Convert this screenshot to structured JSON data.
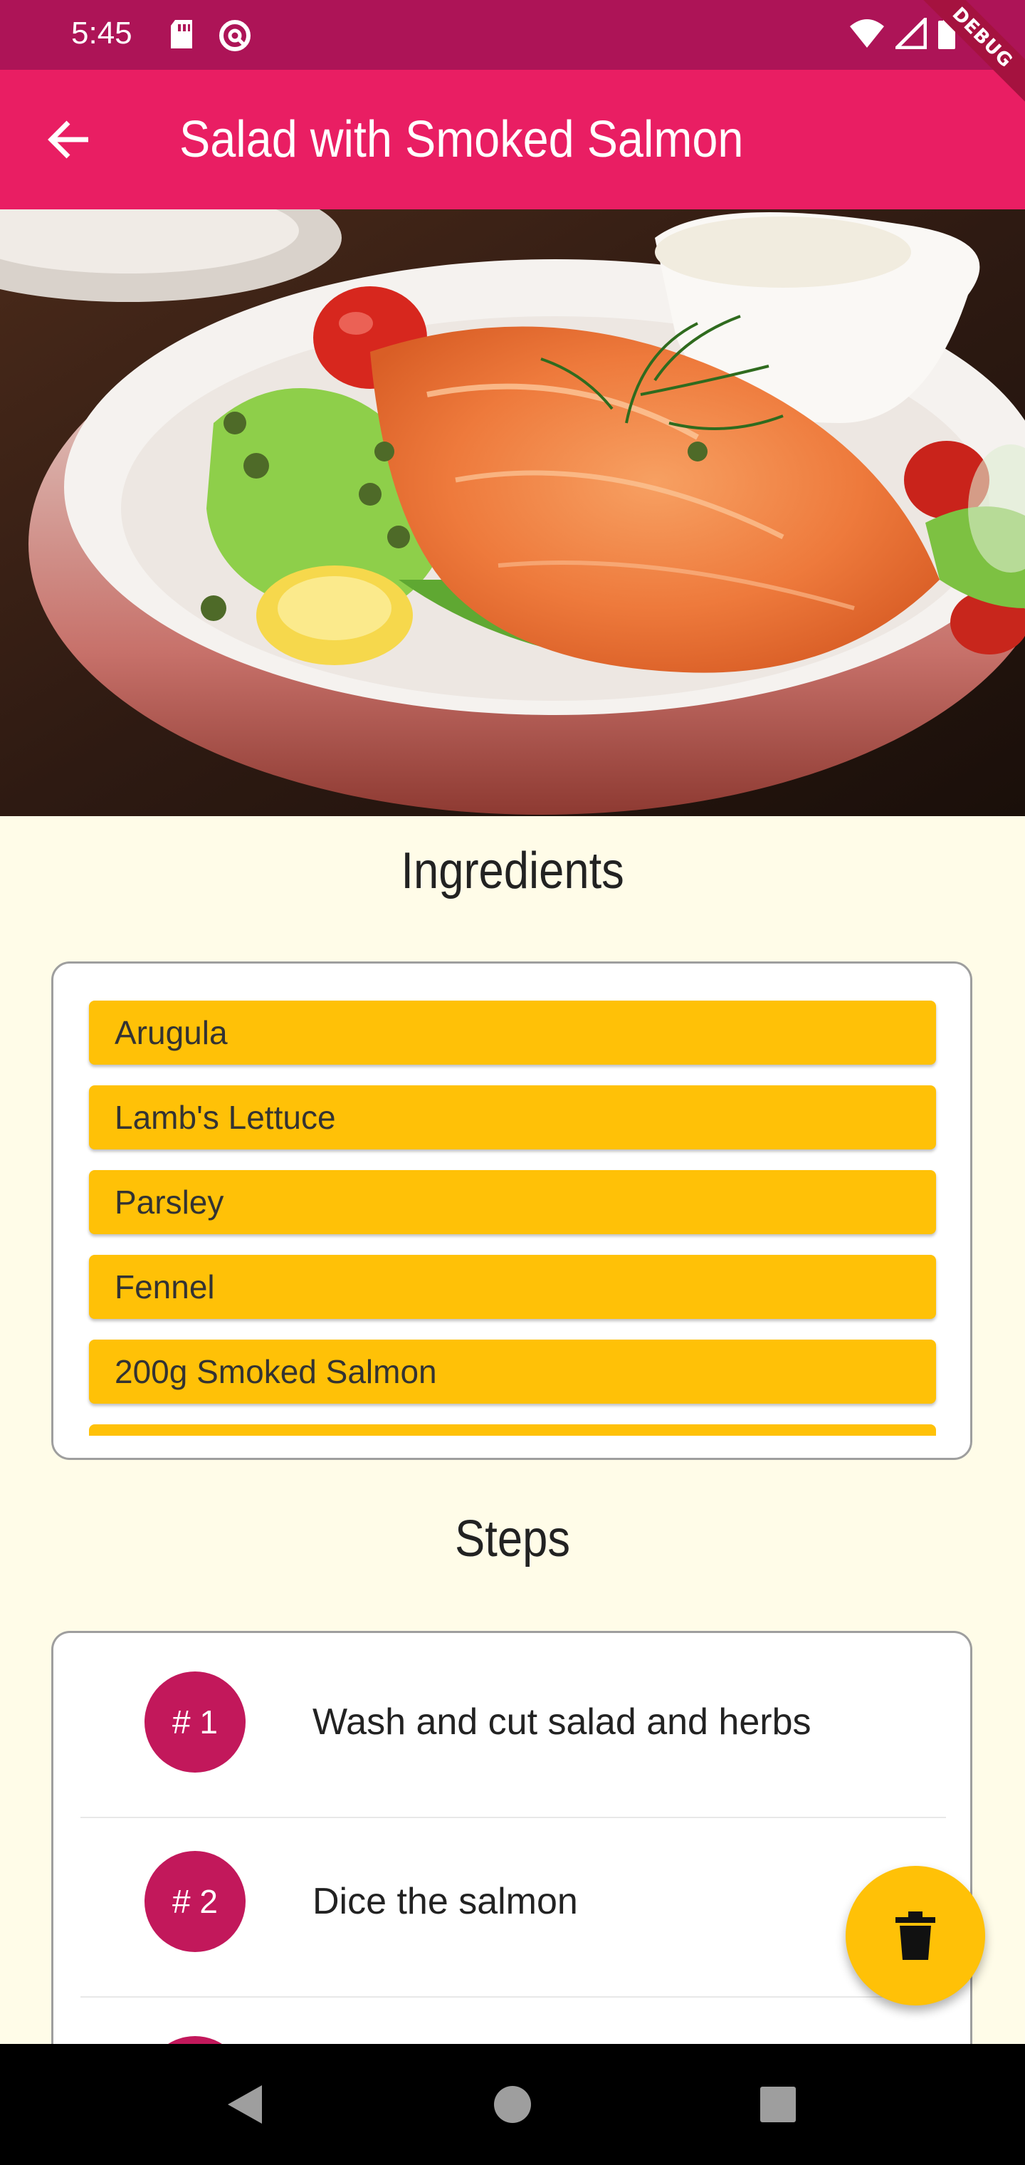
{
  "status_bar": {
    "time": "5:45",
    "debug_label": "DEBUG",
    "icons": [
      "sd-card-icon",
      "do-not-disturb-icon",
      "wifi-icon",
      "signal-icon",
      "battery-icon"
    ]
  },
  "app_bar": {
    "title": "Salad with Smoked Salmon",
    "back_icon": "arrow-back-icon",
    "color": "#E91E63"
  },
  "hero": {
    "image": "smoked-salmon-salad-photo"
  },
  "ingredients": {
    "heading": "Ingredients",
    "items": [
      "Arugula",
      "Lamb's Lettuce",
      "Parsley",
      "Fennel",
      "200g Smoked Salmon"
    ]
  },
  "steps": {
    "heading": "Steps",
    "items": [
      {
        "number": "# 1",
        "text": "Wash and cut salad and herbs"
      },
      {
        "number": "# 2",
        "text": "Dice the salmon"
      }
    ]
  },
  "fab": {
    "icon": "trash-icon",
    "color": "#FFC107"
  },
  "colors": {
    "background": "#FFFCE8",
    "status_bar": "#AD1457",
    "ingredient_chip": "#FFC107",
    "step_circle": "#C2185B"
  }
}
